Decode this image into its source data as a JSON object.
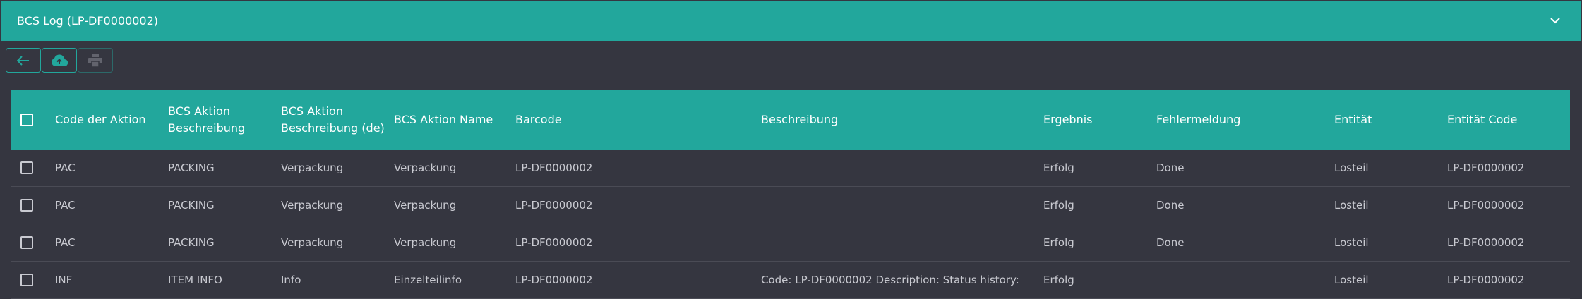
{
  "header": {
    "title": "BCS Log (LP-DF0000002)"
  },
  "toolbar": {
    "buttons": [
      "arrow-left-icon",
      "cloud-upload-icon",
      "printer-icon"
    ]
  },
  "colors": {
    "accent": "#22a79c",
    "background": "#353640",
    "text": "#c9cad1"
  },
  "table": {
    "columns": [
      "Code der Aktion",
      "BCS Aktion Beschreibung",
      "BCS Aktion Beschreibung (de)",
      "BCS Aktion Name",
      "Barcode",
      "Beschreibung",
      "Ergebnis",
      "Fehlermeldung",
      "Entität",
      "Entität Code"
    ],
    "rows": [
      [
        "PAC",
        "PACKING",
        "Verpackung",
        "Verpackung",
        "LP-DF0000002",
        "",
        "Erfolg",
        "Done",
        "Losteil",
        "LP-DF0000002"
      ],
      [
        "PAC",
        "PACKING",
        "Verpackung",
        "Verpackung",
        "LP-DF0000002",
        "",
        "Erfolg",
        "Done",
        "Losteil",
        "LP-DF0000002"
      ],
      [
        "PAC",
        "PACKING",
        "Verpackung",
        "Verpackung",
        "LP-DF0000002",
        "",
        "Erfolg",
        "Done",
        "Losteil",
        "LP-DF0000002"
      ],
      [
        "INF",
        "ITEM INFO",
        "Info",
        "Einzelteilinfo",
        "LP-DF0000002",
        "Code: LP-DF0000002 Description: Status history:",
        "Erfolg",
        "",
        "Losteil",
        "LP-DF0000002"
      ]
    ]
  }
}
